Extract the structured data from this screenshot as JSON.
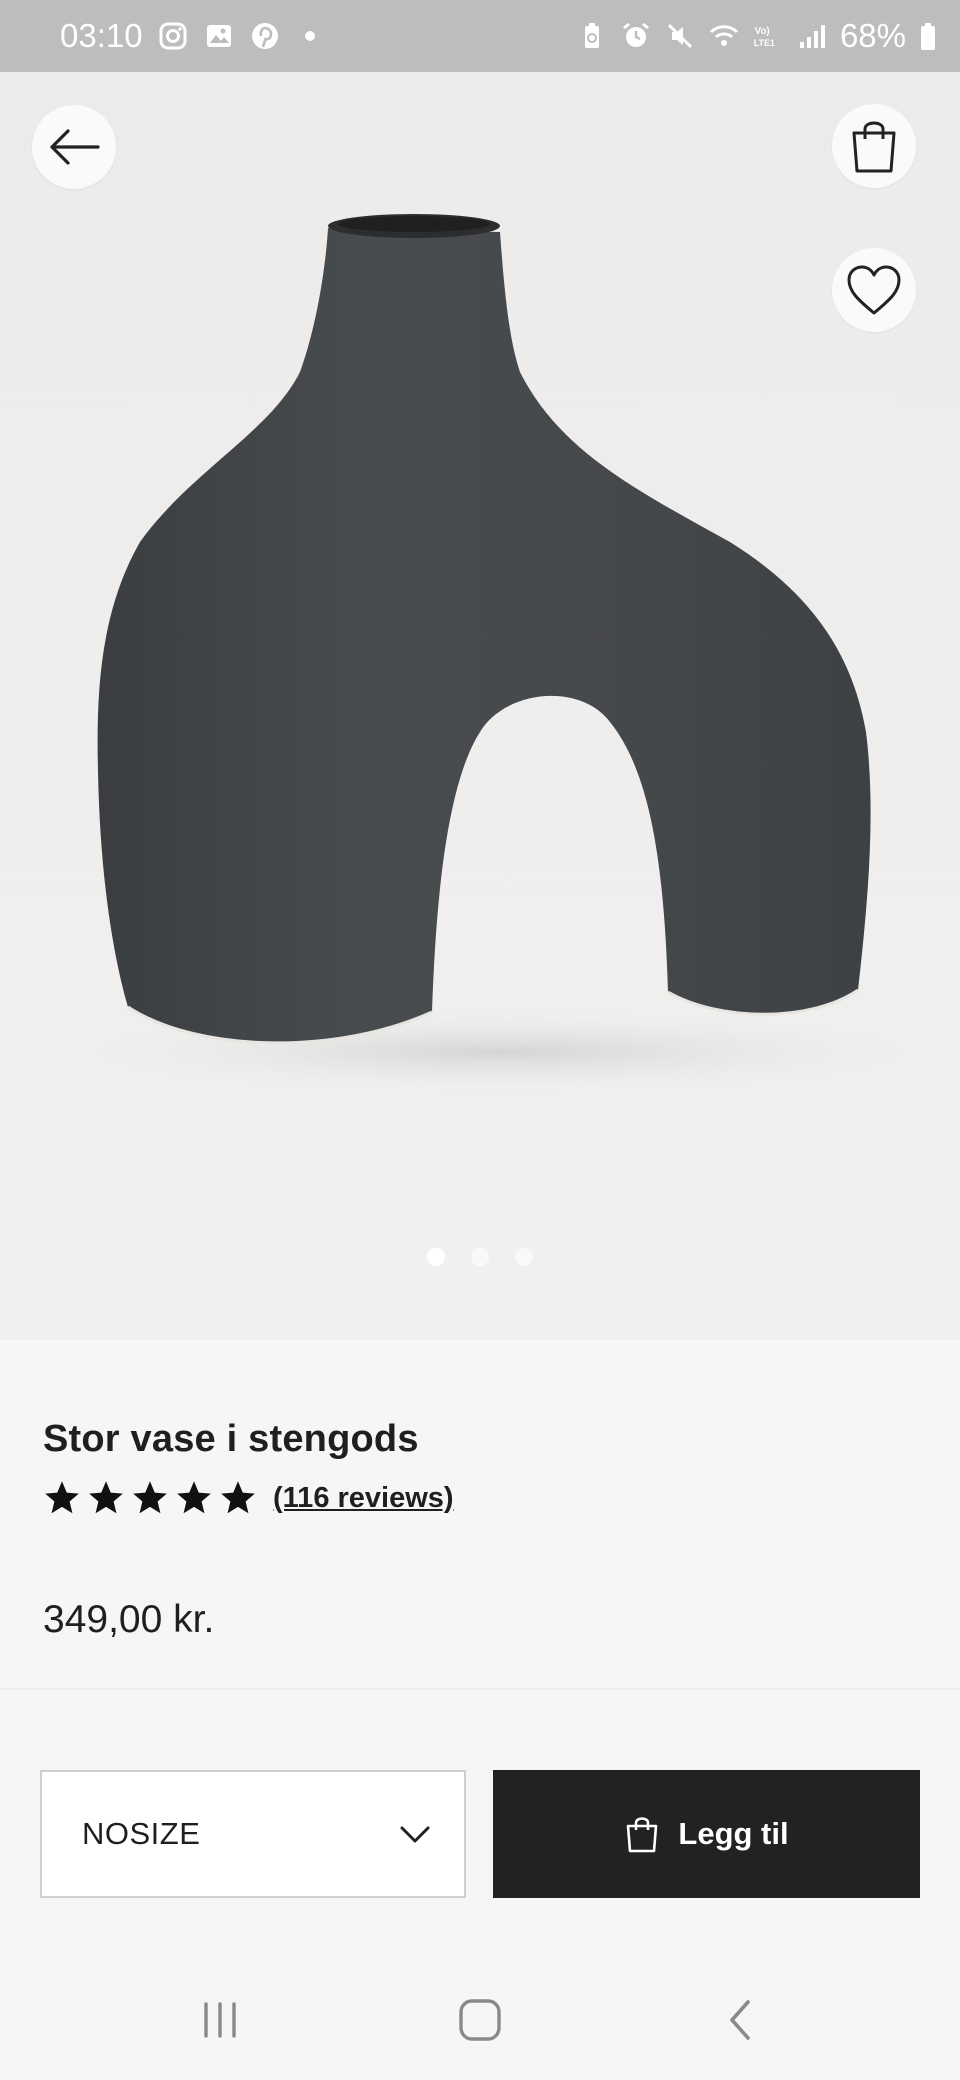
{
  "status_bar": {
    "time": "03:10",
    "battery": "68%",
    "left_icons": [
      "instagram-icon",
      "gallery-icon",
      "pinterest-icon",
      "dot-icon"
    ],
    "right_icons": [
      "battery-saver-icon",
      "alarm-icon",
      "mute-icon",
      "wifi-icon",
      "volte-icon",
      "signal-icon",
      "battery-icon"
    ]
  },
  "hero": {
    "gallery_count": 3,
    "active_index": 0,
    "colors": {
      "vase": "#434649",
      "background": "#eeedec"
    }
  },
  "product": {
    "title": "Stor vase i stengods",
    "rating_stars": 5,
    "reviews": "(116 reviews)",
    "price": "349,00 kr."
  },
  "actions": {
    "size_value": "NOSIZE",
    "add_label": "Legg til"
  },
  "colors": {
    "button_dark": "#222222",
    "page_bg": "#f6f6f6"
  }
}
